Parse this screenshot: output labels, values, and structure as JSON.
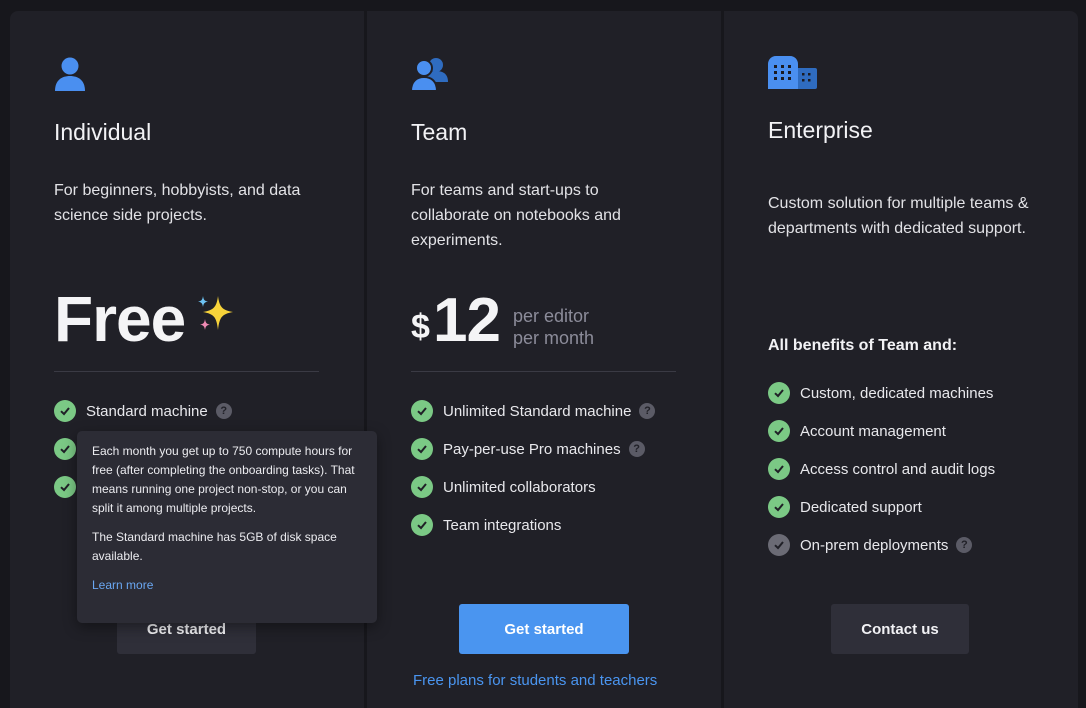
{
  "plans": [
    {
      "icon": "person-icon",
      "title": "Individual",
      "description": "For beginners, hobbyists, and data science side projects.",
      "price": "Free",
      "features": [
        "Standard machine"
      ],
      "button": "Get started"
    },
    {
      "icon": "people-icon",
      "title": "Team",
      "description": "For teams and start-ups to collaborate on notebooks and experiments.",
      "price_currency": "$",
      "price": "12",
      "price_unit_line1": "per editor",
      "price_unit_line2": "per month",
      "features": [
        "Unlimited Standard machine",
        "Pay-per-use Pro machines",
        "Unlimited collaborators",
        "Team integrations"
      ],
      "button": "Get started",
      "link": "Free plans for students and teachers"
    },
    {
      "icon": "building-icon",
      "title": "Enterprise",
      "description": "Custom solution for multiple teams & departments with dedicated support.",
      "benefits_heading": "All benefits of Team and:",
      "features": [
        "Custom, dedicated machines",
        "Account management",
        "Access control and audit logs",
        "Dedicated support",
        "On-prem deployments"
      ],
      "button": "Contact us"
    }
  ],
  "tooltip": {
    "paragraph1": "Each month you get up to 750 compute hours for free (after completing the onboarding tasks). That means running one project non-stop, or you can split it among multiple projects.",
    "paragraph2": "The Standard machine has 5GB of disk space available.",
    "link": "Learn more"
  },
  "help_glyph": "?",
  "colors": {
    "accent": "#4a95f0",
    "check": "#7bc985",
    "card_bg": "#202027"
  }
}
